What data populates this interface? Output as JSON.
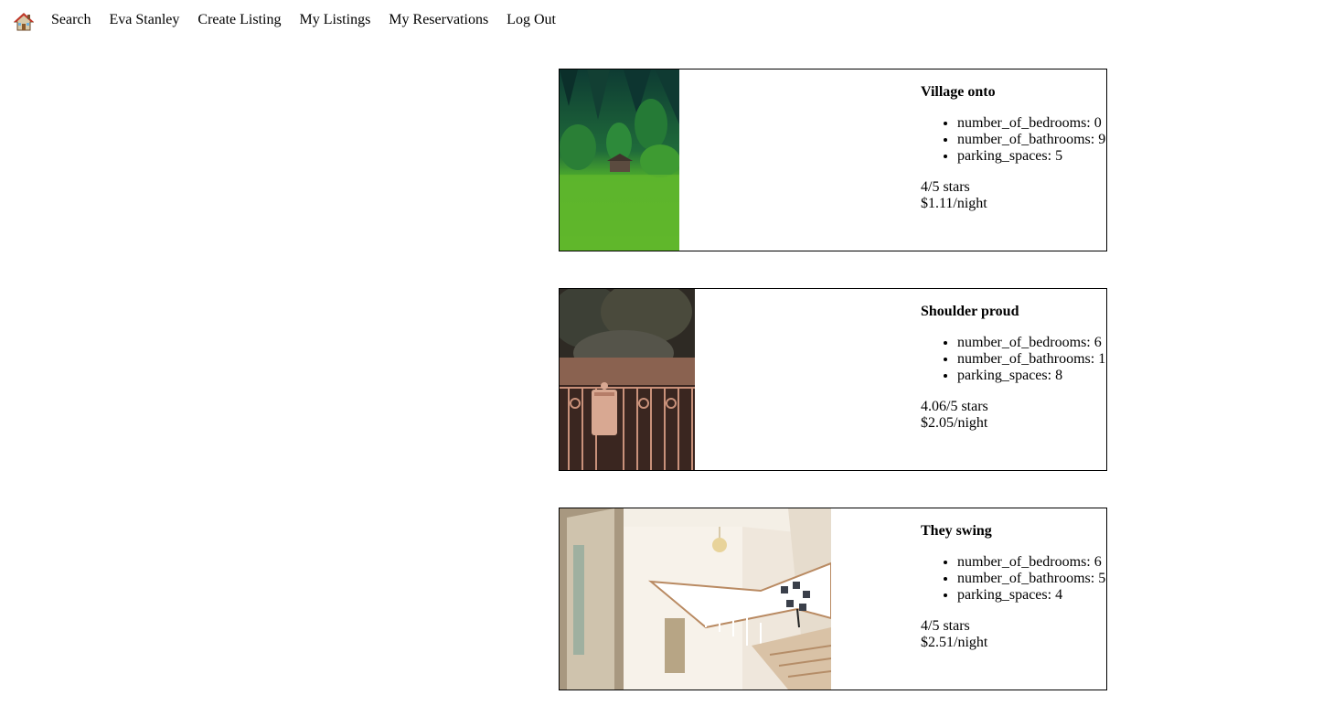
{
  "nav": {
    "home_icon": "house-emoji-icon",
    "links": [
      "Search",
      "Eva Stanley",
      "Create Listing",
      "My Listings",
      "My Reservations",
      "Log Out"
    ]
  },
  "listings": [
    {
      "title": "Village onto",
      "image": "forest-hillside-cabin-photo",
      "properties": [
        "number_of_bedrooms: 0",
        "number_of_bathrooms: 9",
        "parking_spaces: 5"
      ],
      "rating": "4/5 stars",
      "price": "$1.11/night"
    },
    {
      "title": "Shoulder proud",
      "image": "iron-gate-mailbox-photo",
      "properties": [
        "number_of_bedrooms: 6",
        "number_of_bathrooms: 1",
        "parking_spaces: 8"
      ],
      "rating": "4.06/5 stars",
      "price": "$2.05/night"
    },
    {
      "title": "They swing",
      "image": "staircase-foyer-photo",
      "properties": [
        "number_of_bedrooms: 6",
        "number_of_bathrooms: 5",
        "parking_spaces: 4"
      ],
      "rating": "4/5 stars",
      "price": "$2.51/night"
    }
  ]
}
